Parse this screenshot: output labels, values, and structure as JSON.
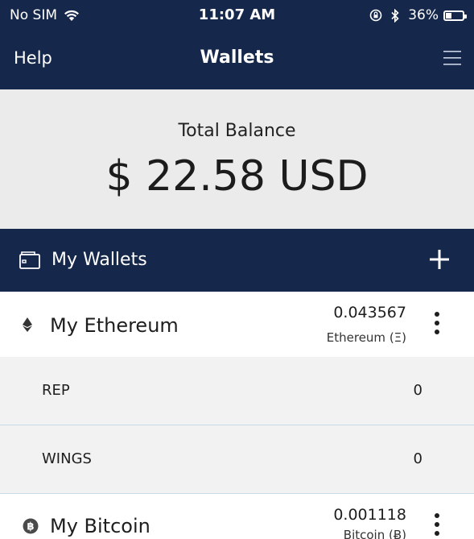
{
  "status_bar": {
    "carrier": "No SIM",
    "time": "11:07 AM",
    "battery": "36%",
    "battery_level": 0.36
  },
  "nav": {
    "help": "Help",
    "title": "Wallets"
  },
  "balance": {
    "label": "Total Balance",
    "amount": "$ 22.58 USD"
  },
  "wallets_section": {
    "label": "My Wallets"
  },
  "wallets": [
    {
      "name": "My Ethereum",
      "amount": "0.043567",
      "unit": "Ethereum (Ξ)",
      "icon": "ethereum-icon",
      "tokens": [
        {
          "name": "REP",
          "value": "0"
        },
        {
          "name": "WINGS",
          "value": "0"
        }
      ]
    },
    {
      "name": "My Bitcoin",
      "amount": "0.001118",
      "unit": "Bitcoin (Ƀ)",
      "icon": "bitcoin-icon"
    }
  ],
  "colors": {
    "navy": "#15284b",
    "balance_bg": "#ebebeb",
    "token_bg": "#f2f2f2",
    "divider": "#c7dbe8"
  }
}
